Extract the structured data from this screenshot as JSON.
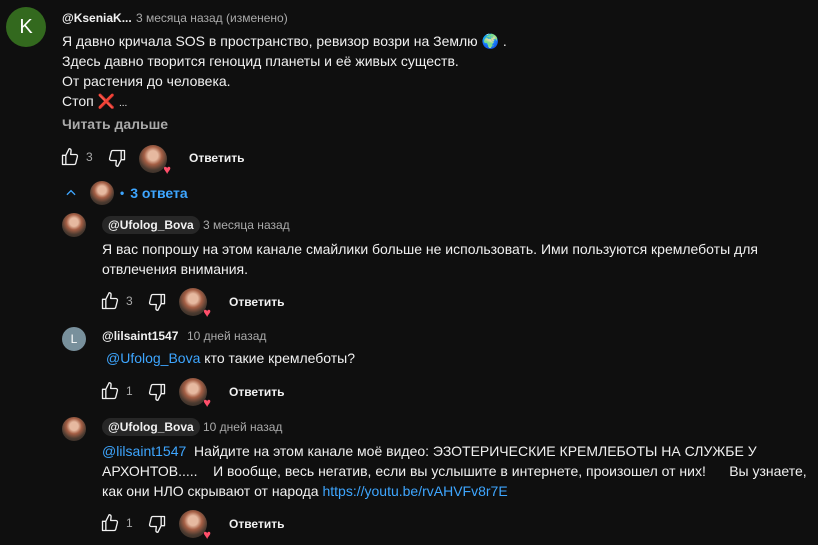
{
  "comment": {
    "avatar_letter": "K",
    "author": "@KseniaK...",
    "time": "3 месяца назад (изменено)",
    "lines": [
      "Я давно кричала SOS в пространство, ревизор возри на Землю",
      "Здесь давно творится геноцид планеты и её живых существ.",
      "От растения до человека.",
      "Стоп"
    ],
    "line1_suffix": ".",
    "emoji_globe": "🌍",
    "emoji_cross": "❌",
    "ellipsis": "...",
    "read_more": "Читать дальше",
    "likes": "3",
    "reply_label": "Ответить"
  },
  "replies_toggle": {
    "label": "3 ответа",
    "dot": "•",
    "chevron": "⌃"
  },
  "replies": [
    {
      "author": "@Ufolog_Bova",
      "time": "3 месяца назад",
      "lines": [
        "Я вас попрошу на этом канале смайлики больше не использовать. Ими пользуются кремлеботы для",
        "отвлечения внимания."
      ],
      "likes": "3",
      "reply_label": "Ответить"
    },
    {
      "avatar_letter": "L",
      "author": "@lilsaint1547",
      "time": "10 дней назад",
      "mention": "@Ufolog_Bova",
      "text": " кто такие кремлеботы?",
      "likes": "1",
      "reply_label": "Ответить"
    },
    {
      "author": "@Ufolog_Bova",
      "time": "10 дней назад",
      "mention": "@lilsaint1547",
      "line1": "  Найдите на этом канале моё видео: ЭЗОТЕРИЧЕСКИЕ КРЕМЛЕБОТЫ НА СЛУЖБЕ У",
      "line2": "АРХОНТОВ.....    И вообще, весь негатив, если вы услышите в интернете, произошел от них!      Вы узнаете,",
      "line3": "как они НЛО скрывают от народа ",
      "link": "https://youtu.be/rvAHVFv8r7E",
      "likes": "1",
      "reply_label": "Ответить"
    }
  ],
  "colors": {
    "background": "#0f0f0f",
    "link": "#3ea6ff",
    "heart": "#ff4e6a",
    "avatar_k": "#33691e",
    "avatar_l": "#78909c"
  }
}
